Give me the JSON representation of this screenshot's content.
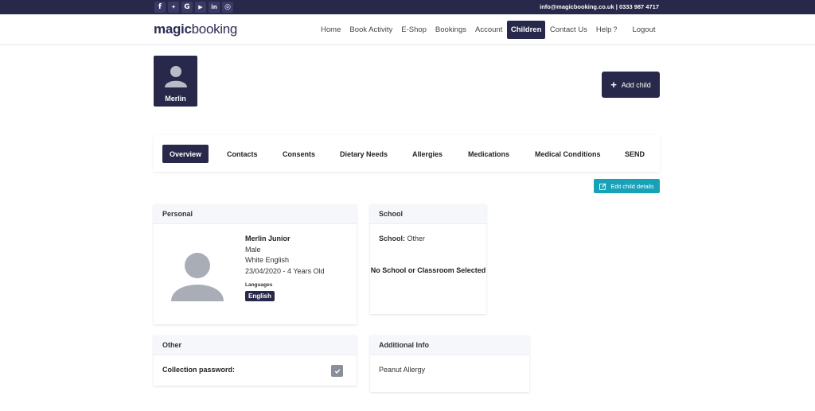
{
  "topbar": {
    "social_icons": [
      {
        "name": "facebook-icon",
        "glyph": "f"
      },
      {
        "name": "twitter-icon",
        "glyph": "🐦"
      },
      {
        "name": "google-icon",
        "glyph": "G"
      },
      {
        "name": "youtube-icon",
        "glyph": "▶"
      },
      {
        "name": "linkedin-icon",
        "glyph": "in"
      },
      {
        "name": "instagram-icon",
        "glyph": "◎"
      }
    ],
    "contact": "info@magicbooking.co.uk | 0333 987 4717"
  },
  "header": {
    "logo_part1": "magic",
    "logo_part2": "booking",
    "nav": {
      "home": "Home",
      "book_activity": "Book Activity",
      "eshop": "E-Shop",
      "bookings": "Bookings",
      "account": "Account",
      "children": "Children",
      "contact_us": "Contact Us",
      "help": "Help",
      "help_icon": "?",
      "logout": "Logout"
    }
  },
  "child_selector": {
    "name": "Merlin",
    "add_child_label": "Add child",
    "add_icon": "+"
  },
  "tabs": {
    "overview": "Overview",
    "contacts": "Contacts",
    "consents": "Consents",
    "dietary": "Dietary Needs",
    "allergies": "Allergies",
    "medications": "Medications",
    "medical": "Medical Conditions",
    "send": "SEND"
  },
  "edit_button": "Edit child details",
  "personal": {
    "title": "Personal",
    "name": "Merlin Junior",
    "gender": "Male",
    "ethnicity": "White English",
    "dob": "23/04/2020 - 4 Years Old",
    "languages_label": "Languages",
    "language": "English"
  },
  "school": {
    "title": "School",
    "school_label": "School:",
    "school_value": "Other",
    "no_school": "No School or Classroom Selected"
  },
  "other": {
    "title": "Other",
    "collection_password_label": "Collection password:"
  },
  "additional": {
    "title": "Additional Info",
    "value": "Peanut Allergy"
  },
  "colors": {
    "brand_navy": "#28284a",
    "accent_teal": "#17a2b8"
  }
}
